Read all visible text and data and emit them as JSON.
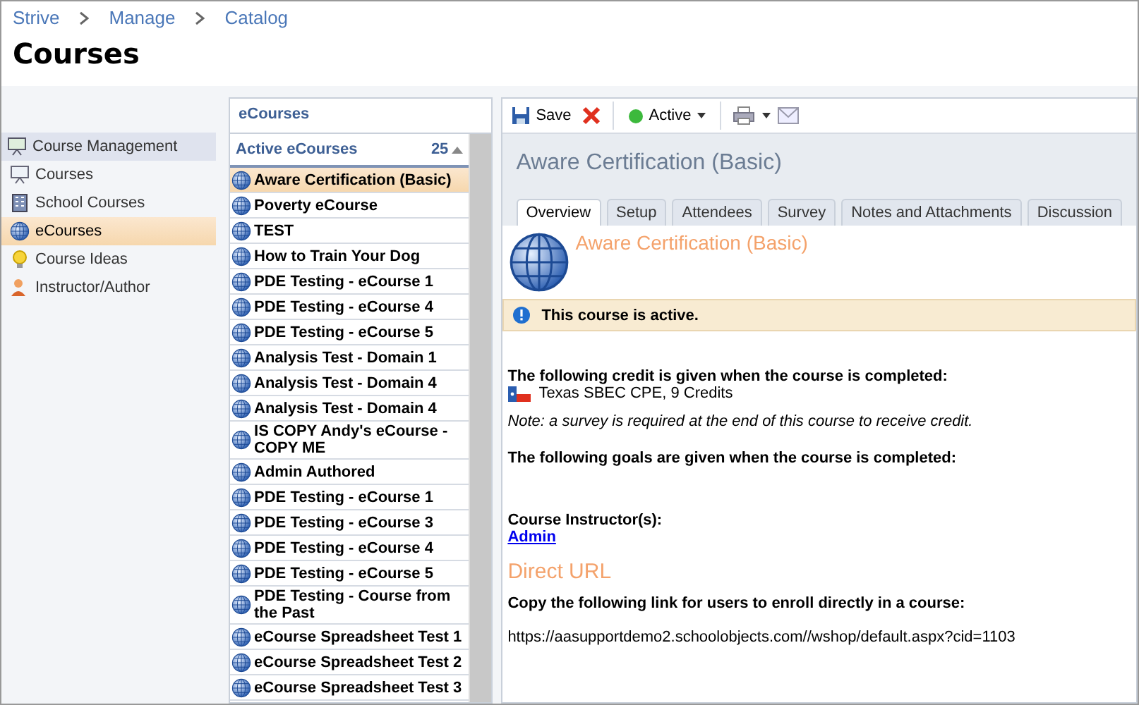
{
  "breadcrumb": [
    "Strive",
    "Manage",
    "Catalog"
  ],
  "page_title": "Courses",
  "sidebar": {
    "header": "Course Management",
    "items": [
      {
        "label": "Courses",
        "kind": "courses",
        "selected": false
      },
      {
        "label": "School Courses",
        "kind": "school",
        "selected": false
      },
      {
        "label": "eCourses",
        "kind": "ecourses",
        "selected": true
      },
      {
        "label": "Course Ideas",
        "kind": "ideas",
        "selected": false
      },
      {
        "label": "Instructor/Author",
        "kind": "instructor",
        "selected": false
      }
    ]
  },
  "list_panel": {
    "title": "eCourses",
    "list_title": "Active eCourses",
    "count": "25",
    "rows": [
      {
        "label": "Aware Certification (Basic)",
        "selected": true
      },
      {
        "label": "Poverty eCourse",
        "selected": false
      },
      {
        "label": "TEST",
        "selected": false
      },
      {
        "label": "How to Train Your Dog",
        "selected": false
      },
      {
        "label": "PDE Testing - eCourse 1",
        "selected": false
      },
      {
        "label": "PDE Testing - eCourse 4",
        "selected": false
      },
      {
        "label": "PDE Testing - eCourse 5",
        "selected": false
      },
      {
        "label": "Analysis Test - Domain 1",
        "selected": false
      },
      {
        "label": "Analysis Test - Domain 4",
        "selected": false
      },
      {
        "label": "Analysis Test - Domain 4",
        "selected": false
      },
      {
        "label": "IS COPY Andy's eCourse - COPY ME",
        "selected": false
      },
      {
        "label": "Admin Authored",
        "selected": false
      },
      {
        "label": "PDE Testing - eCourse 1",
        "selected": false
      },
      {
        "label": "PDE Testing - eCourse 3",
        "selected": false
      },
      {
        "label": "PDE Testing - eCourse 4",
        "selected": false
      },
      {
        "label": "PDE Testing - eCourse 5",
        "selected": false
      },
      {
        "label": "PDE Testing - Course from the Past",
        "selected": false
      },
      {
        "label": "eCourse Spreadsheet Test 1",
        "selected": false
      },
      {
        "label": "eCourse Spreadsheet Test 2",
        "selected": false
      },
      {
        "label": "eCourse Spreadsheet Test 3",
        "selected": false
      }
    ]
  },
  "toolbar": {
    "save": "Save",
    "status": "Active"
  },
  "detail": {
    "title": "Aware Certification (Basic)",
    "tabs": [
      {
        "label": "Overview",
        "selected": true
      },
      {
        "label": "Setup",
        "selected": false
      },
      {
        "label": "Attendees",
        "selected": false
      },
      {
        "label": "Survey",
        "selected": false
      },
      {
        "label": "Notes and Attachments",
        "selected": false
      },
      {
        "label": "Discussion",
        "selected": false
      }
    ],
    "course_name": "Aware Certification (Basic)",
    "alert": "This course is active.",
    "credit_heading": "The following credit is given when the course is completed:",
    "credit": "Texas SBEC CPE, 9 Credits",
    "note": "Note: a survey is required at the end of this course to receive credit.",
    "goals_heading": "The following goals are given when the course is completed:",
    "instructors_heading": "Course Instructor(s):",
    "instructor": "Admin",
    "direct_url_heading": "Direct URL",
    "direct_url_label": "Copy the following link for users to enroll directly in a course:",
    "url": "https://aasupportdemo2.schoolobjects.com//wshop/default.aspx?cid=1103"
  }
}
